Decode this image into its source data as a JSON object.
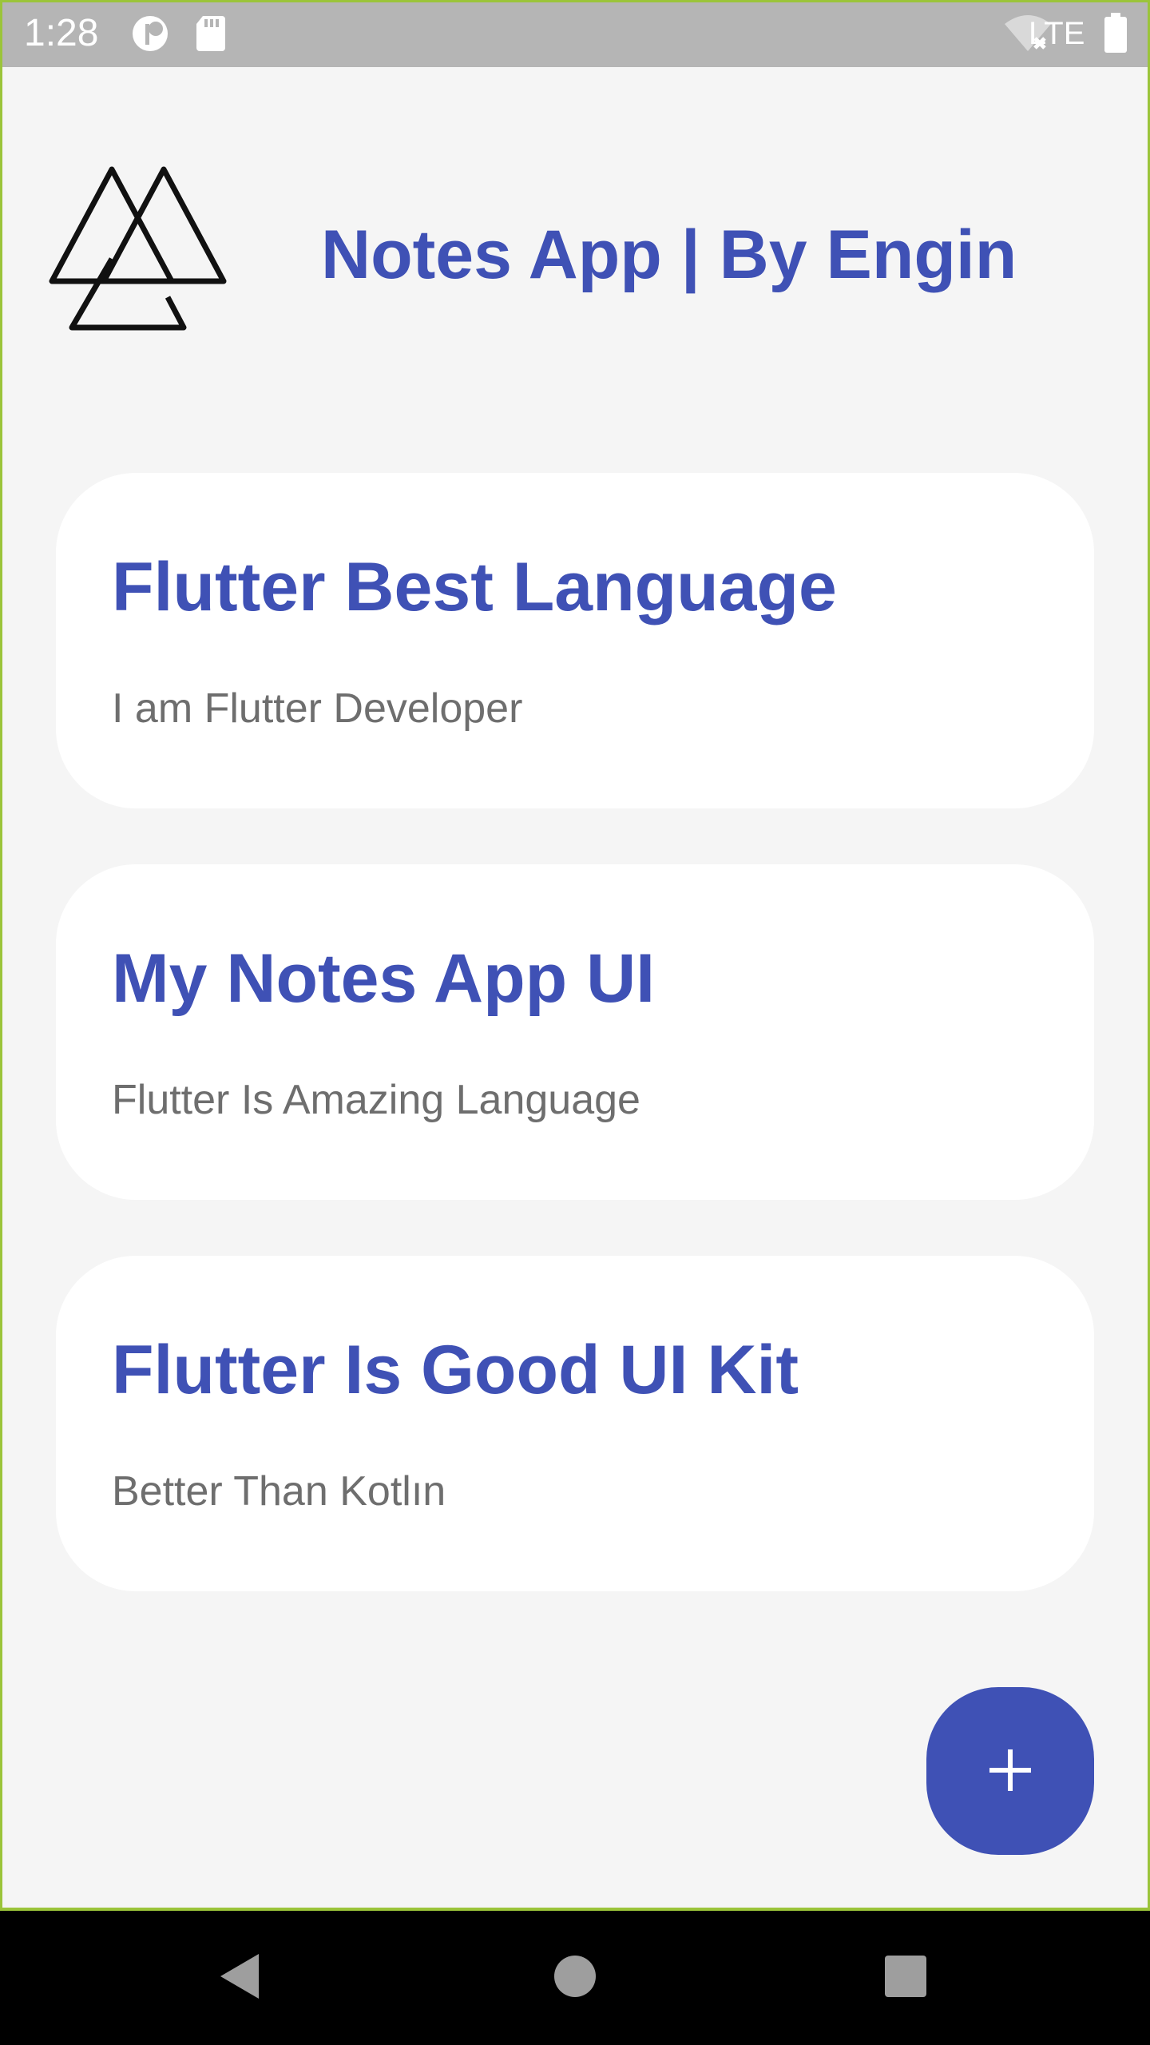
{
  "status_bar": {
    "time": "1:28",
    "carrier": "LTE",
    "icons": [
      "notification-circle-icon",
      "sd-card-icon",
      "wifi-off-icon",
      "battery-icon"
    ]
  },
  "header": {
    "title": "Notes App | By Engin",
    "logo": "triangles-logo"
  },
  "notes": [
    {
      "title": "Flutter Best Language",
      "body": "I am Flutter Developer"
    },
    {
      "title": "My Notes App UI",
      "body": "Flutter Is Amazing Language"
    },
    {
      "title": "Flutter Is Good UI Kit",
      "body": "Better Than Kotlın"
    }
  ],
  "fab": {
    "icon": "plus-icon"
  },
  "nav_bar": {
    "items": [
      "back-icon",
      "home-icon",
      "recents-icon"
    ]
  },
  "colors": {
    "accent": "#3f51b5",
    "background": "#f5f5f5",
    "card": "#ffffff",
    "body_text": "#6e6e6e",
    "status_bar": "#b5b5b5"
  }
}
